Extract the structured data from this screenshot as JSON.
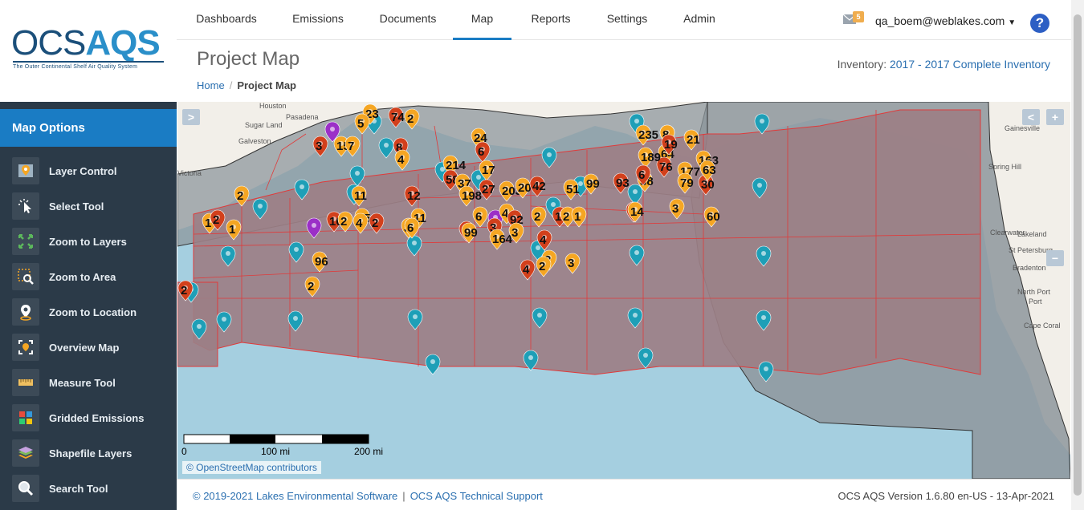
{
  "brand": {
    "logo_ocs": "OCS",
    "logo_aqs": "AQS",
    "tagline": "The Outer Continental Shelf Air Quality System"
  },
  "sidebar": {
    "header": "Map Options",
    "items": [
      {
        "label": "Layer Control",
        "icon": "layer-control-icon"
      },
      {
        "label": "Select Tool",
        "icon": "select-cursor-icon"
      },
      {
        "label": "Zoom to Layers",
        "icon": "zoom-layers-icon"
      },
      {
        "label": "Zoom to Area",
        "icon": "zoom-area-icon"
      },
      {
        "label": "Zoom to Location",
        "icon": "location-pin-icon"
      },
      {
        "label": "Overview Map",
        "icon": "overview-map-icon"
      },
      {
        "label": "Measure Tool",
        "icon": "ruler-icon"
      },
      {
        "label": "Gridded Emissions",
        "icon": "grid-icon"
      },
      {
        "label": "Shapefile Layers",
        "icon": "layers-stack-icon"
      },
      {
        "label": "Search Tool",
        "icon": "magnifier-icon"
      }
    ]
  },
  "nav": {
    "tabs": [
      "Dashboards",
      "Emissions",
      "Documents",
      "Map",
      "Reports",
      "Settings",
      "Admin"
    ],
    "active": "Map",
    "mail_count": "5",
    "user": "qa_boem@weblakes.com",
    "help": "?"
  },
  "page": {
    "title": "Project Map",
    "inventory_label": "Inventory:",
    "inventory_value": "2017 - 2017 Complete Inventory",
    "breadcrumb_home": "Home",
    "breadcrumb_sep": "/",
    "breadcrumb_current": "Project Map"
  },
  "map": {
    "toggle_button": ">",
    "collapse_button": "<",
    "zoom_in": "+",
    "zoom_out": "−",
    "attribution": "© OpenStreetMap contributors",
    "scale_labels": [
      "0",
      "100 mi",
      "200 mi"
    ],
    "place_labels": [
      "Houston",
      "Sugar Land",
      "Pasadena",
      "Galveston",
      "Victoria",
      "Gainesville",
      "Spring Hill",
      "Clearwater",
      "Lakeland",
      "St Petersburg",
      "Bradenton",
      "North Port",
      "Port",
      "Cape Coral"
    ],
    "marker_labels": [
      "23",
      "741",
      "2",
      "5",
      "3",
      "15",
      "7",
      "8",
      "4",
      "24",
      "6",
      "17",
      "214",
      "58",
      "37",
      "198",
      "27",
      "203",
      "20",
      "42",
      "51",
      "99",
      "93",
      "38",
      "64",
      "76",
      "177",
      "79",
      "30",
      "163",
      "189",
      "6",
      "63",
      "60",
      "9",
      "235",
      "8",
      "19",
      "21",
      "11",
      "12",
      "11",
      "15",
      "102",
      "2",
      "4",
      "2",
      "34",
      "6",
      "8",
      "99",
      "6",
      "3",
      "164",
      "4",
      "92",
      "3",
      "2",
      "161",
      "2",
      "1",
      "3",
      "14",
      "3",
      "4",
      "2",
      "2",
      "4",
      "3",
      "1",
      "2",
      "1",
      "2",
      "2",
      "96",
      "2"
    ],
    "colors": {
      "land": "#f2efe9",
      "water": "#a5cfe0",
      "lease_fill": "#9c7f86",
      "lease_line": "#e03a3a",
      "gray_area": "#8e979c",
      "pin_teal": "#1e9fb7",
      "pin_orange": "#f5a623",
      "pin_red": "#d2401c",
      "pin_purple": "#9b2fc7"
    }
  },
  "footer": {
    "copyright": "© 2019-2021 Lakes Environmental Software",
    "separator": "|",
    "support": "OCS AQS Technical Support",
    "version": "OCS AQS Version 1.6.80 en-US - 13-Apr-2021"
  }
}
